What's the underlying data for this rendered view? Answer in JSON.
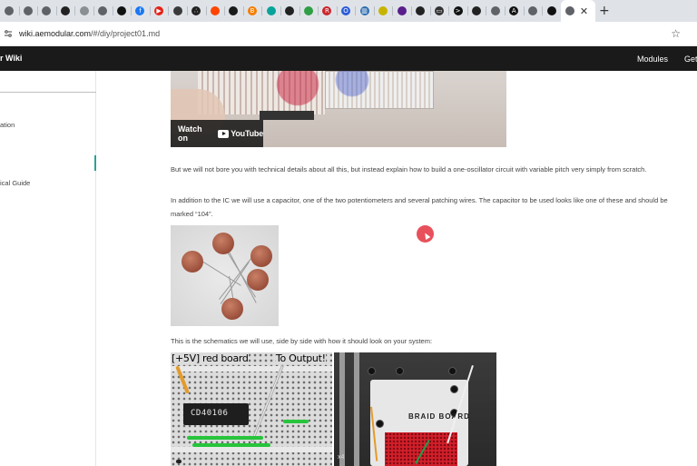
{
  "browser": {
    "tabs": [
      {
        "icon": "globe-icon",
        "color": "#5f6368",
        "glyph": ""
      },
      {
        "icon": "globe-icon",
        "color": "#5f6368",
        "glyph": ""
      },
      {
        "icon": "globe-icon",
        "color": "#5f6368",
        "glyph": ""
      },
      {
        "icon": "github-icon",
        "color": "#222222",
        "glyph": ""
      },
      {
        "icon": "globe-icon",
        "color": "#8a8f95",
        "glyph": ""
      },
      {
        "icon": "globe-icon",
        "color": "#5f6368",
        "glyph": ""
      },
      {
        "icon": "circle-logo-icon",
        "color": "#111111",
        "glyph": ""
      },
      {
        "icon": "facebook-icon",
        "color": "#1877f2",
        "glyph": "f"
      },
      {
        "icon": "youtube-icon",
        "color": "#e62117",
        "glyph": "▶"
      },
      {
        "icon": "dark-logo-icon",
        "color": "#3a3a3a",
        "glyph": ""
      },
      {
        "icon": "dots-logo-icon",
        "color": "#222222",
        "glyph": "∴"
      },
      {
        "icon": "reddit-icon",
        "color": "#ff4500",
        "glyph": ""
      },
      {
        "icon": "compass-icon",
        "color": "#1a1a1a",
        "glyph": ""
      },
      {
        "icon": "blogger-icon",
        "color": "#f57d00",
        "glyph": "B"
      },
      {
        "icon": "teal-logo-icon",
        "color": "#0aa39b",
        "glyph": ""
      },
      {
        "icon": "github-icon",
        "color": "#222222",
        "glyph": ""
      },
      {
        "icon": "leaf-logo-icon",
        "color": "#2f9e44",
        "glyph": ""
      },
      {
        "icon": "red-box-logo-icon",
        "color": "#c9252c",
        "glyph": "R"
      },
      {
        "icon": "ring-logo-icon",
        "color": "#2a5bd7",
        "glyph": "O"
      },
      {
        "icon": "chart-logo-icon",
        "color": "#2b6cb0",
        "glyph": "▥"
      },
      {
        "icon": "yellow-logo-icon",
        "color": "#c7b400",
        "glyph": ""
      },
      {
        "icon": "purple-box-icon",
        "color": "#5a1e8c",
        "glyph": ""
      },
      {
        "icon": "github-icon",
        "color": "#222222",
        "glyph": ""
      },
      {
        "icon": "keyboard-icon",
        "color": "#333333",
        "glyph": "▭"
      },
      {
        "icon": "terminal-icon",
        "color": "#111111",
        "glyph": ">"
      },
      {
        "icon": "github-icon",
        "color": "#222222",
        "glyph": ""
      },
      {
        "icon": "globe-icon",
        "color": "#5f6368",
        "glyph": ""
      },
      {
        "icon": "letter-a-icon",
        "color": "#111111",
        "glyph": "A"
      },
      {
        "icon": "globe-icon",
        "color": "#5f6368",
        "glyph": ""
      },
      {
        "icon": "dark-logo-icon",
        "color": "#111111",
        "glyph": ""
      }
    ],
    "active_tab_icon": "globe-icon",
    "close_glyph": "✕",
    "new_tab_glyph": "+",
    "url_host": "wiki.aemodular.com",
    "url_path": "/#/diy/project01.md",
    "star_glyph": "☆"
  },
  "site": {
    "brand_visible": "r Wiki",
    "nav_modules": "Modules",
    "nav_get": "Get"
  },
  "sidebar": {
    "link_1": "ation",
    "link_2": "ical Guide",
    "accent_color": "#2aa198"
  },
  "content": {
    "video": {
      "watch_label": "Watch on",
      "platform": "YouTube"
    },
    "paragraph_1": "But we will not bore you with technical details about all this, but instead explain how to build a one-oscillator circuit with variable pitch very simply from scratch.",
    "paragraph_2": "In addition to the IC we will use a capacitor, one of the two potentiometers and several patching wires. The capacitor to be used looks like one of these and should be marked “104”.",
    "paragraph_3": "This is the schematics we will use, side by side with how it should look on your system:",
    "schematic": {
      "label_left": "[+5V] red board",
      "label_right": "To Output!",
      "chip_label": "CD40106"
    },
    "board_photo": {
      "label": "BRAID BOARD",
      "corner_label": "x4"
    }
  }
}
